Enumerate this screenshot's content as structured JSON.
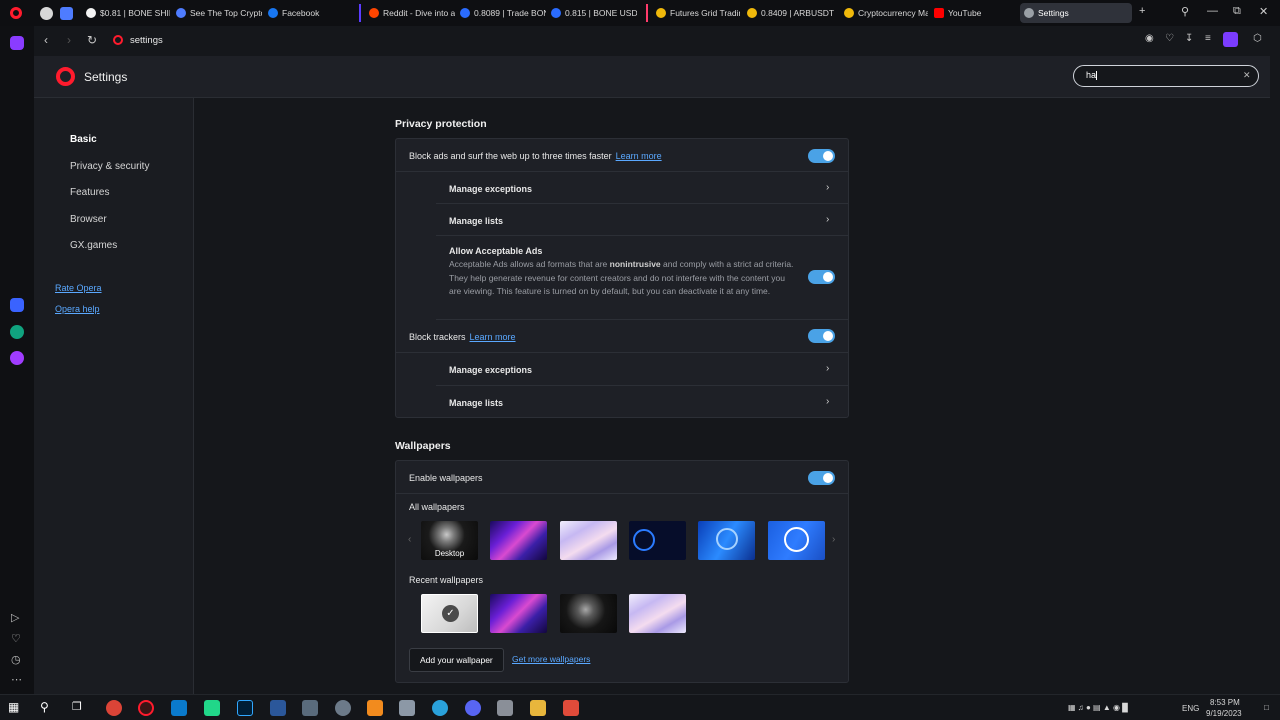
{
  "browser": {
    "tabs": [
      {
        "title": "$0.81 | BONE SHIBA",
        "color": "#f3f3f3"
      },
      {
        "title": "See The Top Crypto",
        "color": "#4e7cff"
      },
      {
        "title": "Facebook",
        "color": "#1877f2"
      },
      {
        "title": "Reddit - Dive into a",
        "color": "#ff4500"
      },
      {
        "title": "0.8089 | Trade BONE",
        "color": "#2a6cff"
      },
      {
        "title": "0.815 | BONE USDT",
        "color": "#2a6cff"
      },
      {
        "title": "Futures Grid Trading",
        "color": "#f0b90b"
      },
      {
        "title": "0.8409 | ARBUSDT",
        "color": "#f0b90b"
      },
      {
        "title": "Cryptocurrency Ma",
        "color": "#f0b90b"
      },
      {
        "title": "YouTube",
        "color": "#ff0000"
      },
      {
        "title": "Settings",
        "color": "#9aa0a6"
      }
    ],
    "address": "settings"
  },
  "header": {
    "title": "Settings",
    "search_value": "ha"
  },
  "nav": {
    "items": [
      "Basic",
      "Privacy & security",
      "Features",
      "Browser",
      "GX.games"
    ],
    "links": [
      "Rate Opera",
      "Opera help"
    ]
  },
  "privacy": {
    "title": "Privacy protection",
    "block_ads": "Block ads and surf the web up to three times faster",
    "learn_more": "Learn more",
    "manage_exceptions": "Manage exceptions",
    "manage_lists": "Manage lists",
    "acceptable_title": "Allow Acceptable Ads",
    "acceptable_desc_pre": "Acceptable Ads allows ad formats that are ",
    "acceptable_desc_bold": "nonintrusive",
    "acceptable_desc_post": " and comply with a strict ad criteria. They help generate revenue for content creators and do not interfere with the content you are viewing. This feature is turned on by default, but you can deactivate it at any time.",
    "block_trackers": "Block trackers"
  },
  "wallpapers": {
    "title": "Wallpapers",
    "enable": "Enable wallpapers",
    "all": "All wallpapers",
    "desktop_caption": "Desktop",
    "recent": "Recent wallpapers",
    "add_button": "Add your wallpaper",
    "get_more": "Get more wallpapers"
  },
  "taskbar": {
    "lang": "ENG",
    "time": "8:53 PM",
    "date": "9/19/2023"
  },
  "colors": {
    "accent": "#4aa2e6",
    "opera_red": "#ff1b2d",
    "link": "#5aa8ff"
  }
}
